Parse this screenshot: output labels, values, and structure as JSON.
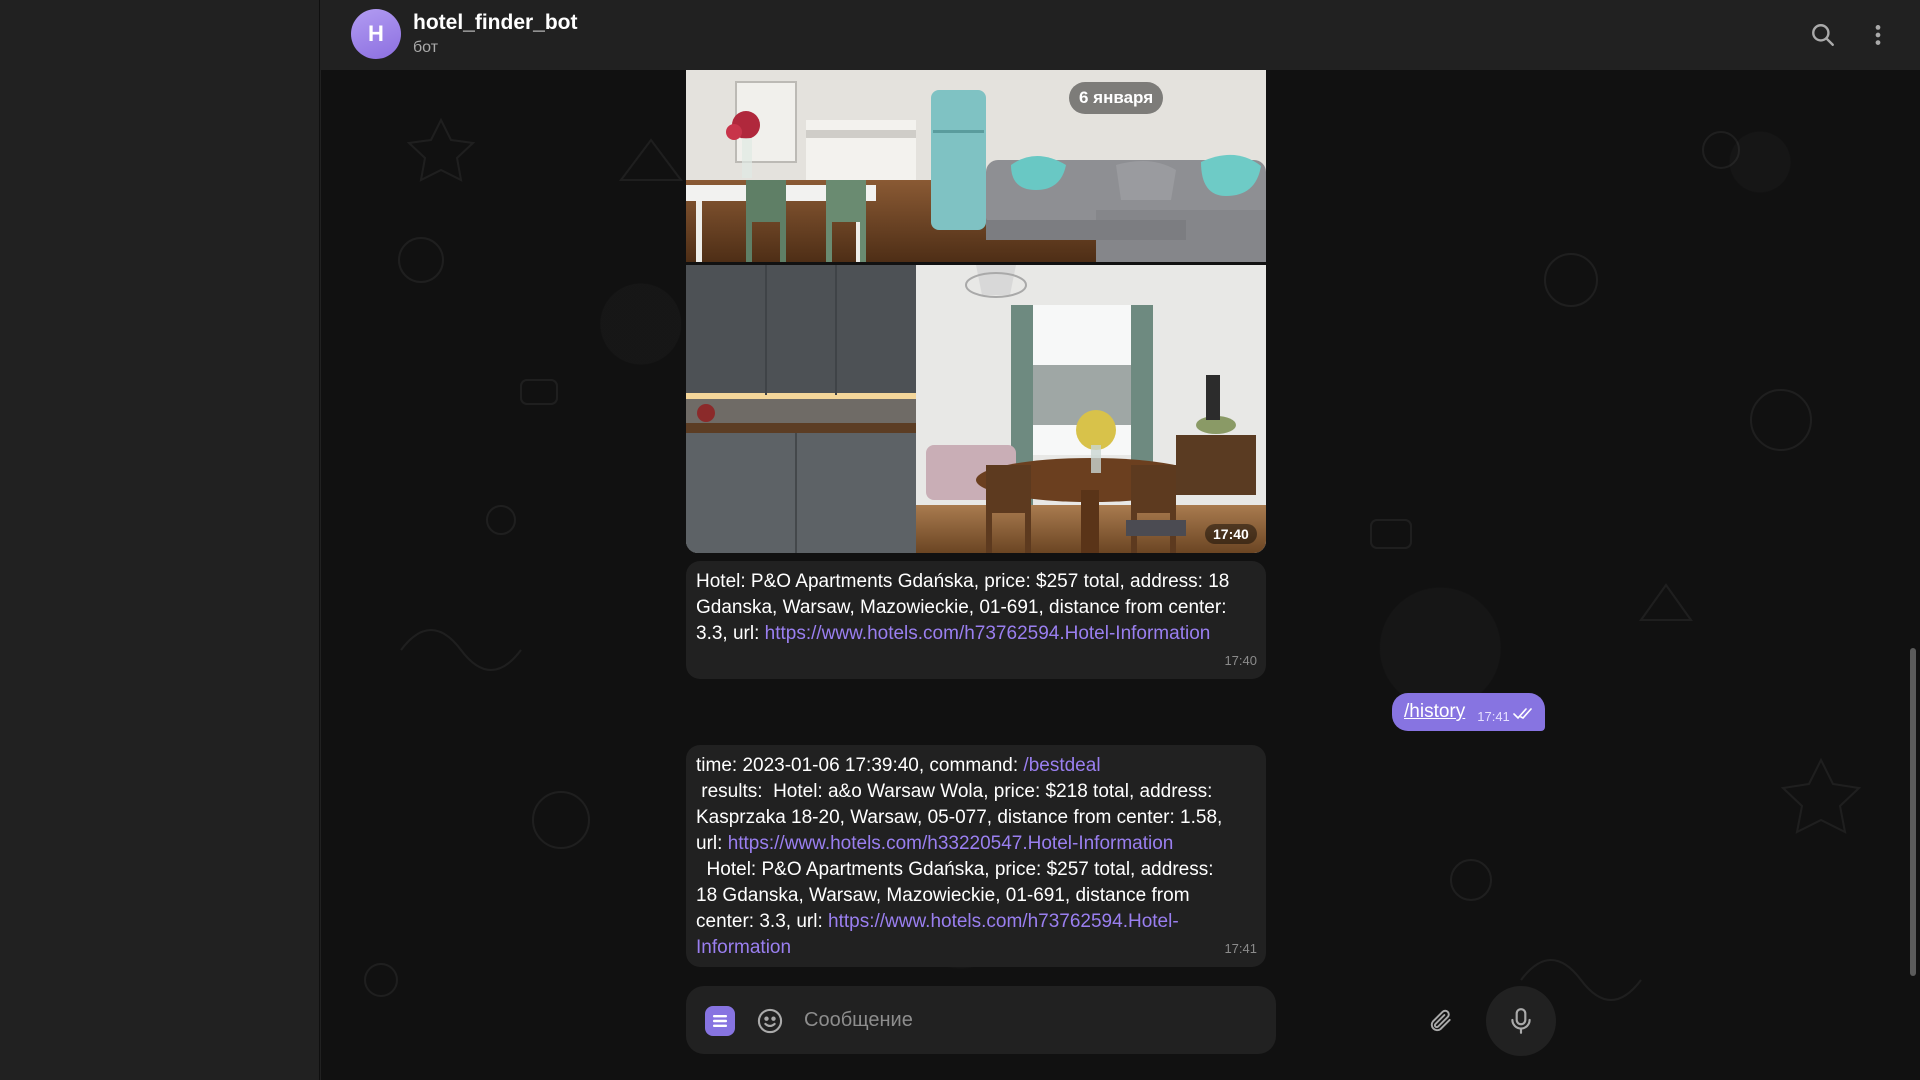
{
  "header": {
    "avatar_letter": "H",
    "title": "hotel_finder_bot",
    "subtitle": "бот",
    "icons": [
      "search-icon",
      "more-vertical-icon"
    ]
  },
  "photos": {
    "date_label": "6 января",
    "time": "17:40",
    "items": [
      "kitchen-living-room-photo",
      "kitchen-dining-room-photo"
    ]
  },
  "messages": {
    "hotel_result": {
      "text": "Hotel: P&O Apartments Gdańska, price: $257 total, address: 18 Gdanska, Warsaw, Mazowieckie, 01-691, distance from center: 3.3, url: ",
      "url": "https://www.hotels.com/h73762594.Hotel-Information",
      "time": "17:40"
    },
    "user_command": {
      "text": "/history",
      "time": "17:41",
      "status": "read"
    },
    "history_result": {
      "l1_prefix": "time: 2023-01-06 17:39:40, command: ",
      "l1_command": "/bestdeal",
      "l2": " results:  Hotel: a&o Warsaw Wola, price: $218 total, address:",
      "l3": "Kasprzaka 18-20, Warsaw, 05-077, distance from center: 1.58,",
      "l4_prefix": "url: ",
      "l4_url": "https://www.hotels.com/h33220547.Hotel-Information",
      "l5": "  Hotel: P&O Apartments Gdańska, price: $257 total, address:",
      "l6": "18 Gdanska, Warsaw, Mazowieckie, 01-691, distance from",
      "l7_prefix": "center: 3.3, url: ",
      "l7_url": "https://www.hotels.com/h73762594.Hotel-",
      "l8_url": "Information",
      "time": "17:41"
    }
  },
  "composer": {
    "placeholder": "Сообщение"
  },
  "colors": {
    "accent": "#8774e1",
    "link": "#9a7ff0",
    "bubble_in": "#212121",
    "panel": "#212121"
  }
}
